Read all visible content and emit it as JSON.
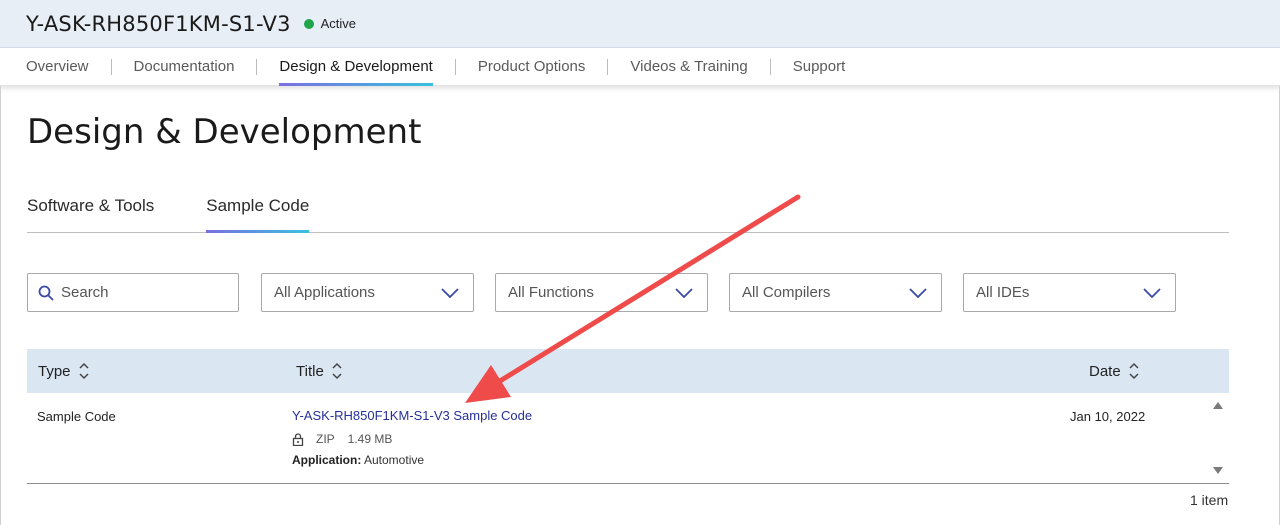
{
  "header": {
    "part_number": "Y-ASK-RH850F1KM-S1-V3",
    "status": "Active",
    "status_color": "#1fa64a",
    "background": "#e8eef6"
  },
  "nav": {
    "tabs": [
      {
        "label": "Overview"
      },
      {
        "label": "Documentation"
      },
      {
        "label": "Design & Development",
        "active": true
      },
      {
        "label": "Product Options"
      },
      {
        "label": "Videos & Training"
      },
      {
        "label": "Support"
      }
    ]
  },
  "page": {
    "heading": "Design & Development"
  },
  "subtabs": [
    {
      "label": "Software & Tools"
    },
    {
      "label": "Sample Code",
      "active": true
    }
  ],
  "filters": {
    "search_placeholder": "Search",
    "selects": [
      {
        "value": "All Applications"
      },
      {
        "value": "All Functions"
      },
      {
        "value": "All Compilers"
      },
      {
        "value": "All IDEs"
      }
    ]
  },
  "table": {
    "columns": {
      "type": "Type",
      "title": "Title",
      "date": "Date"
    },
    "rows": [
      {
        "type": "Sample Code",
        "title": "Y-ASK-RH850F1KM-S1-V3 Sample Code",
        "format": "ZIP",
        "size": "1.49 MB",
        "application_label": "Application:",
        "application": "Automotive",
        "date": "Jan 10, 2022"
      }
    ],
    "item_count": "1 item"
  },
  "colors": {
    "link": "#27309a",
    "accent_gradient_start": "#7b6fe0",
    "accent_gradient_end": "#38c1de",
    "table_header_bg": "#dae7f3",
    "annotation_arrow": "#ef4b4b"
  }
}
